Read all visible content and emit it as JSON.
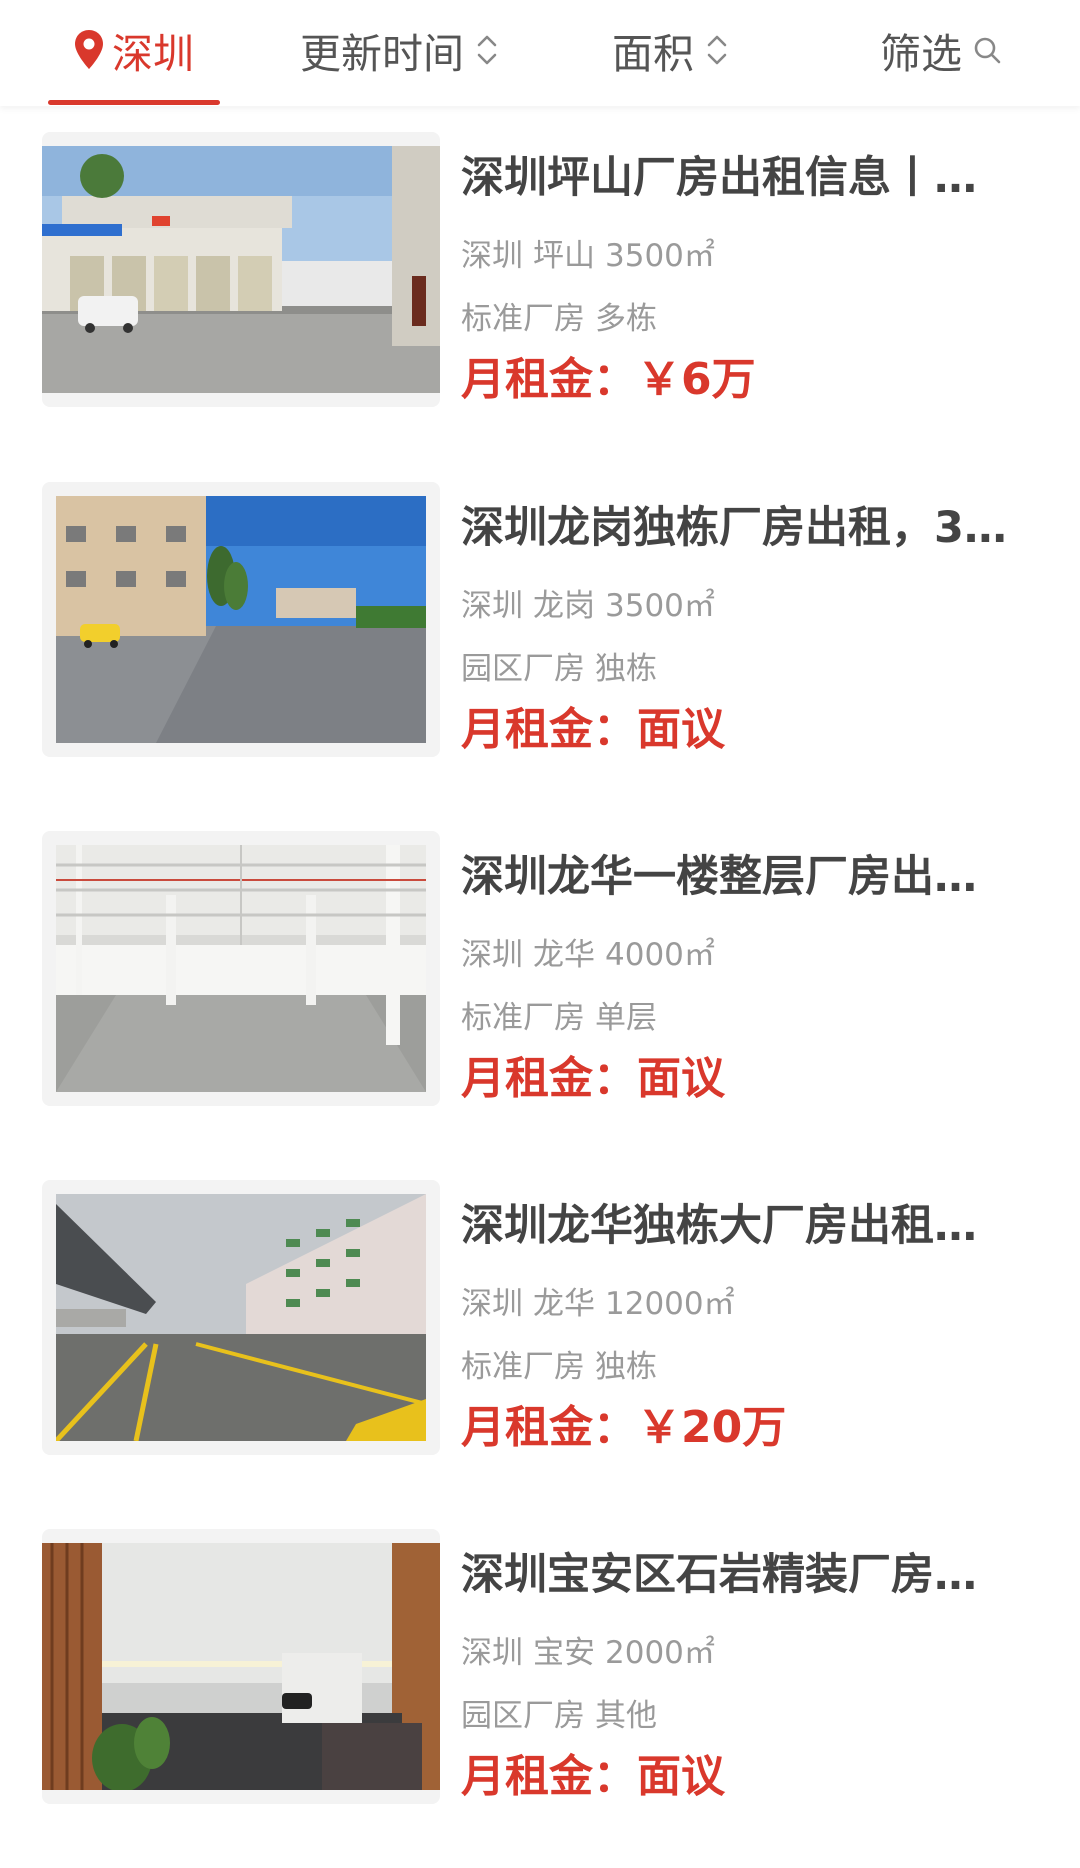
{
  "filters": {
    "city": "深圳",
    "sort_time": "更新时间",
    "sort_area": "面积",
    "filter": "筛选"
  },
  "colors": {
    "accent": "#d9382c",
    "title_text": "#444444",
    "meta_text": "#9a9a9a"
  },
  "listings": [
    {
      "title": "深圳坪山厂房出租信息丨…",
      "city": "深圳",
      "district": "坪山",
      "area": "3500㎡",
      "category": "标准厂房",
      "building": "多栋",
      "rent_label": "月租金：",
      "rent_value": "￥6万"
    },
    {
      "title": "深圳龙岗独栋厂房出租，3…",
      "city": "深圳",
      "district": "龙岗",
      "area": "3500㎡",
      "category": "园区厂房",
      "building": "独栋",
      "rent_label": "月租金：",
      "rent_value": "面议"
    },
    {
      "title": "深圳龙华一楼整层厂房出…",
      "city": "深圳",
      "district": "龙华",
      "area": "4000㎡",
      "category": "标准厂房",
      "building": "单层",
      "rent_label": "月租金：",
      "rent_value": "面议"
    },
    {
      "title": "深圳龙华独栋大厂房出租…",
      "city": "深圳",
      "district": "龙华",
      "area": "12000㎡",
      "category": "标准厂房",
      "building": "独栋",
      "rent_label": "月租金：",
      "rent_value": "￥20万"
    },
    {
      "title": "深圳宝安区石岩精装厂房…",
      "city": "深圳",
      "district": "宝安",
      "area": "2000㎡",
      "category": "园区厂房",
      "building": "其他",
      "rent_label": "月租金：",
      "rent_value": "面议"
    }
  ]
}
